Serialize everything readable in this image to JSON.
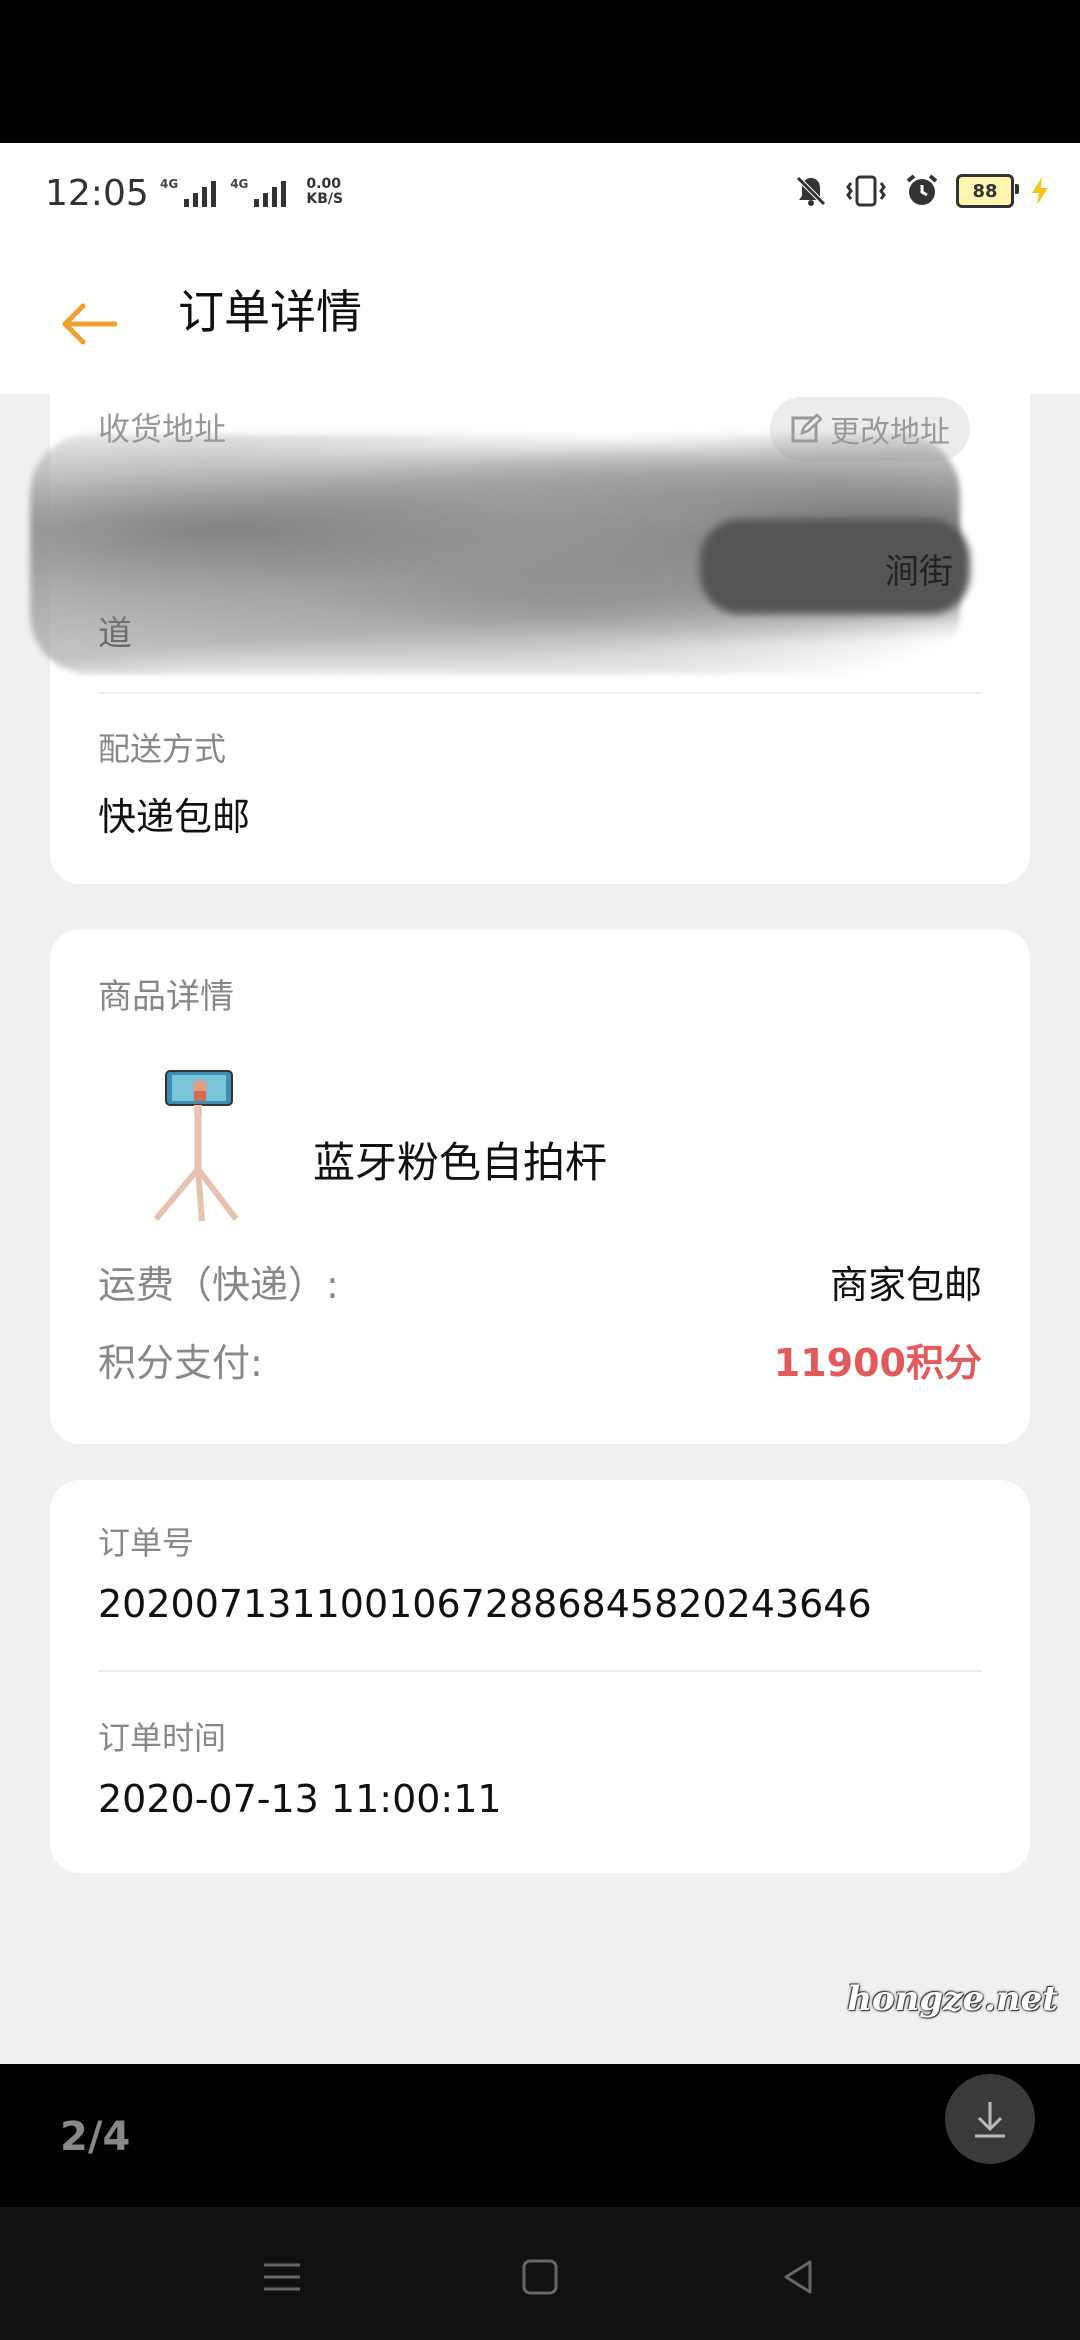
{
  "status_bar": {
    "time": "12:05",
    "network_1": "4G",
    "network_2": "4G",
    "net_speed_value": "0.00",
    "net_speed_unit": "KB/S",
    "battery_level": "88",
    "icons": [
      "mute-icon",
      "vibrate-icon",
      "alarm-icon",
      "battery-icon",
      "charging-icon"
    ]
  },
  "header": {
    "title": "订单详情",
    "back_icon": "arrow-left-icon"
  },
  "address_section": {
    "label": "收货地址",
    "change_button": "更改地址",
    "visible_street_fragment": "涧街",
    "visible_line3_fragment": "道"
  },
  "shipping": {
    "label": "配送方式",
    "value": "快递包邮"
  },
  "goods": {
    "label": "商品详情",
    "product_name": "蓝牙粉色自拍杆",
    "freight_label": "运费（快递）:",
    "freight_value": "商家包邮",
    "points_label": "积分支付:",
    "points_value": "11900积分"
  },
  "order": {
    "number_label": "订单号",
    "number_value": "202007131100106728868458202436​46",
    "time_label": "订单时间",
    "time_value": "2020-07-13 11:00:11"
  },
  "watermark": "hongze.net",
  "viewer": {
    "page_counter": "2/4"
  },
  "colors": {
    "accent": "#f0a030",
    "points_red": "#e35a5a",
    "background": "#f0f0f0"
  }
}
